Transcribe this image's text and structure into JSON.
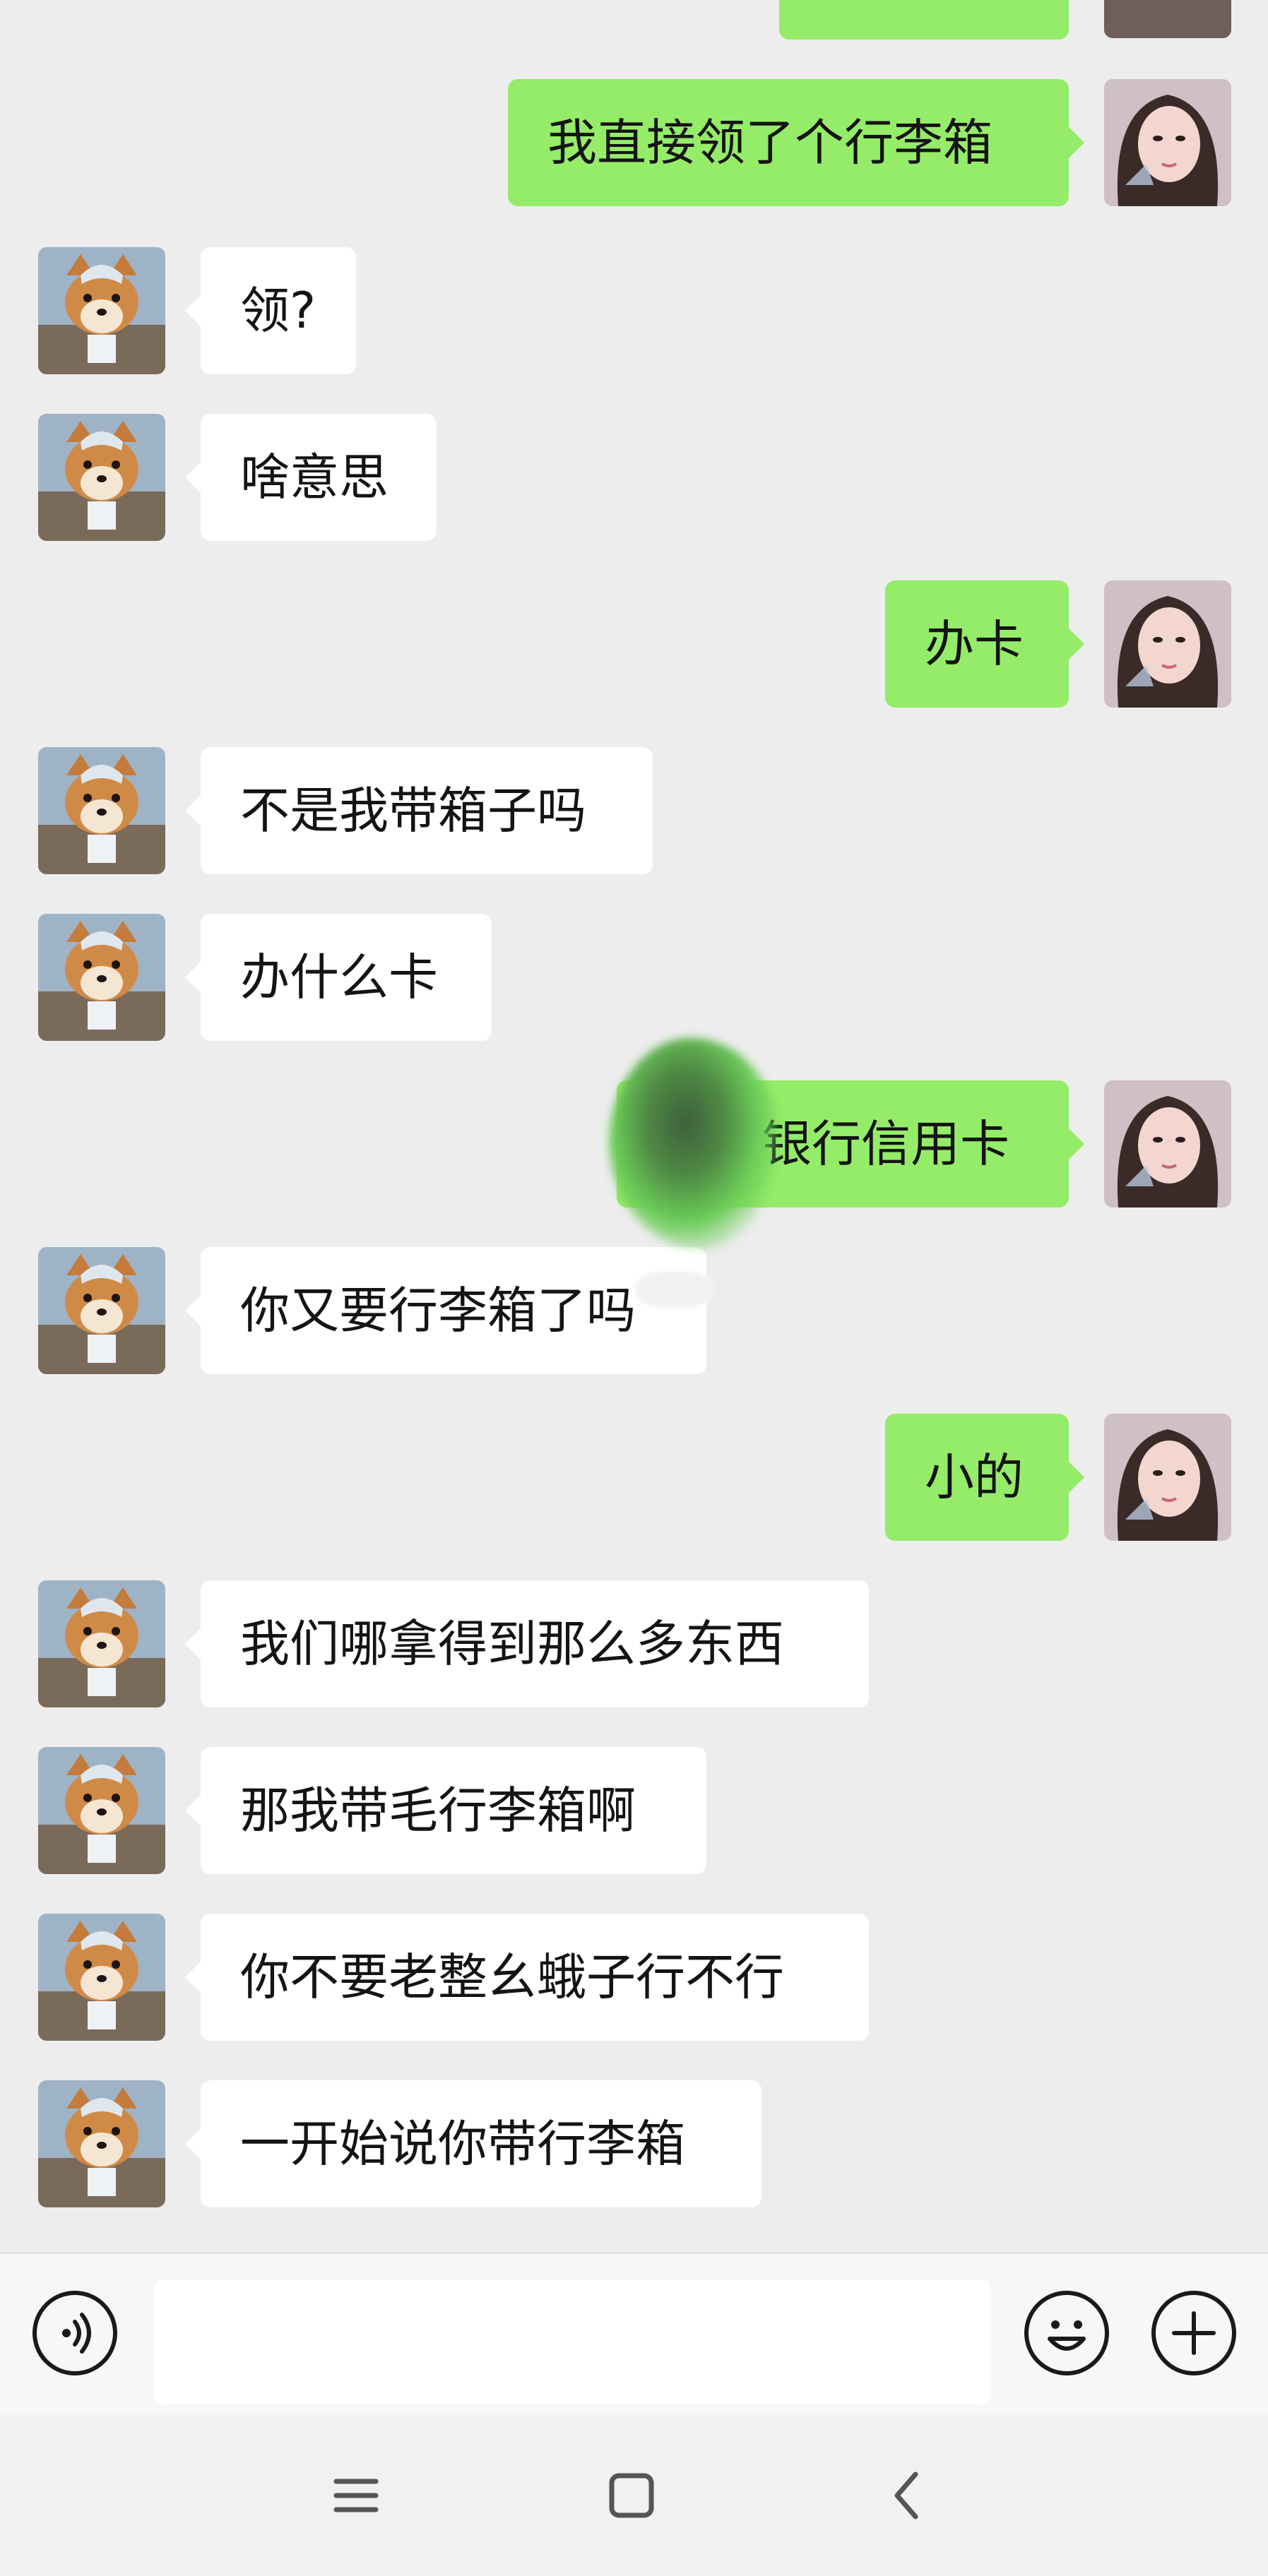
{
  "colors": {
    "background": "#ededed",
    "incoming_bubble": "#ffffff",
    "outgoing_bubble": "#95ec69",
    "text": "#141414"
  },
  "messages": [
    {
      "side": "out",
      "text": "我直接领了个行李箱",
      "avatar": "girl-avatar"
    },
    {
      "side": "in",
      "text": "领?",
      "avatar": "shiba-dog-avatar"
    },
    {
      "side": "in",
      "text": "啥意思",
      "avatar": "shiba-dog-avatar"
    },
    {
      "side": "out",
      "text": "办卡",
      "avatar": "girl-avatar"
    },
    {
      "side": "in",
      "text": "不是我带箱子吗",
      "avatar": "shiba-dog-avatar"
    },
    {
      "side": "in",
      "text": "办什么卡",
      "avatar": "shiba-dog-avatar"
    },
    {
      "side": "out",
      "text": "银行信用卡",
      "avatar": "girl-avatar"
    },
    {
      "side": "in",
      "text": "你又要行李箱了吗",
      "avatar": "shiba-dog-avatar"
    },
    {
      "side": "out",
      "text": "小的",
      "avatar": "girl-avatar"
    },
    {
      "side": "in",
      "text": "我们哪拿得到那么多东西",
      "avatar": "shiba-dog-avatar"
    },
    {
      "side": "in",
      "text": "那我带毛行李箱啊",
      "avatar": "shiba-dog-avatar"
    },
    {
      "side": "in",
      "text": "你不要老整幺蛾子行不行",
      "avatar": "shiba-dog-avatar"
    },
    {
      "side": "in",
      "text": "一开始说你带行李箱",
      "avatar": "shiba-dog-avatar"
    }
  ],
  "input_bar": {
    "voice_icon": "voice-icon",
    "text_value": "",
    "emoji_icon": "emoji-icon",
    "plus_icon": "plus-icon"
  },
  "nav_bar": {
    "menu_icon": "menu-icon",
    "home_icon": "home-icon",
    "back_icon": "back-icon"
  }
}
